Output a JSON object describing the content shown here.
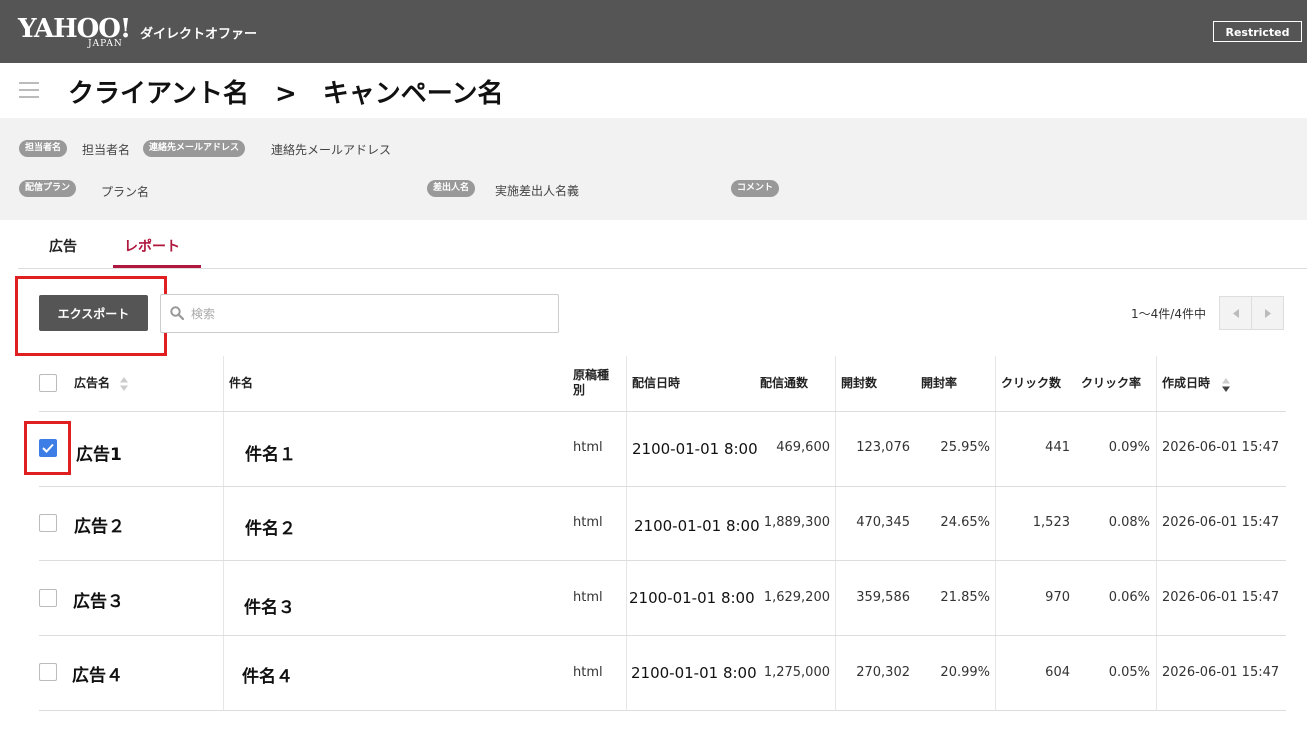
{
  "header": {
    "logo_main": "YAHOO!",
    "logo_sub": "JAPAN",
    "product": "ダイレクトオファー",
    "restricted": "Restricted"
  },
  "page": {
    "title": "クライアント名　>　キャンペーン名"
  },
  "info": {
    "owner_label": "担当者名",
    "owner_value": "担当者名",
    "email_label": "連絡先メールアドレス",
    "email_value": "連絡先メールアドレス",
    "plan_label": "配信プラン",
    "plan_value": "プラン名",
    "sender_label": "差出人名",
    "sender_value": "実施差出人名義",
    "comment_label": "コメント"
  },
  "tabs": [
    {
      "label": "広告",
      "active": false
    },
    {
      "label": "レポート",
      "active": true
    }
  ],
  "toolbar": {
    "export_label": "エクスポート",
    "search_placeholder": "検索",
    "pagination": "1〜4件/4件中"
  },
  "table": {
    "columns": [
      "広告名",
      "件名",
      "原稿種別",
      "配信日時",
      "配信通数",
      "開封数",
      "開封率",
      "クリック数",
      "クリック率",
      "作成日時"
    ],
    "rows": [
      {
        "checked": true,
        "ad_name": "広告1",
        "subject": "件名１",
        "type": "html",
        "datetime": "2100-01-01 8:00",
        "sent": "469,600",
        "opens": "123,076",
        "open_rate": "25.95%",
        "clicks": "441",
        "click_rate": "0.09%",
        "created": "2026-06-01 15:47"
      },
      {
        "checked": false,
        "ad_name": "広告２",
        "subject": "件名２",
        "type": "html",
        "datetime": "2100-01-01 8:00",
        "sent": "1,889,300",
        "opens": "470,345",
        "open_rate": "24.65%",
        "clicks": "1,523",
        "click_rate": "0.08%",
        "created": "2026-06-01 15:47"
      },
      {
        "checked": false,
        "ad_name": "広告３",
        "subject": "件名３",
        "type": "html",
        "datetime": "2100-01-01 8:00",
        "sent": "1,629,200",
        "opens": "359,586",
        "open_rate": "21.85%",
        "clicks": "970",
        "click_rate": "0.06%",
        "created": "2026-06-01 15:47"
      },
      {
        "checked": false,
        "ad_name": "広告４",
        "subject": "件名４",
        "type": "html",
        "datetime": "2100-01-01 8:00",
        "sent": "1,275,000",
        "opens": "270,302",
        "open_rate": "20.99%",
        "clicks": "604",
        "click_rate": "0.05%",
        "created": "2026-06-01 15:47"
      }
    ]
  },
  "colors": {
    "header_bg": "#555555",
    "accent": "#b0173e",
    "highlight": "#e02020",
    "checkbox_checked": "#3c7ee6"
  }
}
